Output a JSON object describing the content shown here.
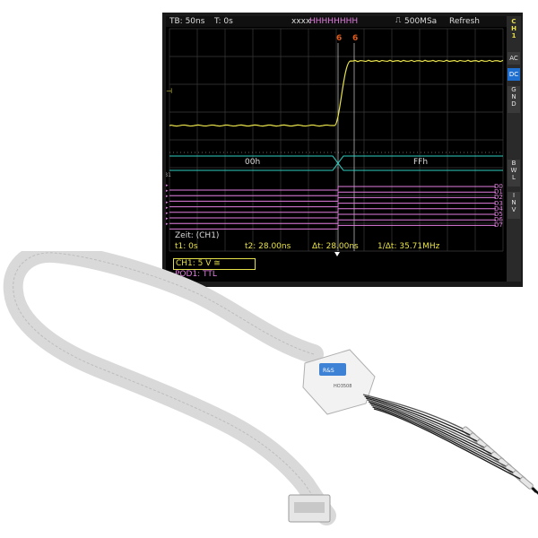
{
  "status_bar": {
    "timebase": "TB: 50ns",
    "trigger_time": "T: 0s",
    "trigger_pattern_x": "xxxx",
    "trigger_pattern_h": "HHHHHHHH",
    "sample_rate": "500MSa",
    "mode": "Refresh"
  },
  "channel_menu": {
    "title_line1": "C",
    "title_line2": "H",
    "title_line3": "1",
    "buttons": [
      {
        "label": "AC"
      },
      {
        "label": "DC",
        "active": true
      },
      {
        "label": "G N D"
      },
      {
        "label": "B W L"
      },
      {
        "label": "I N V"
      }
    ]
  },
  "waveform": {
    "bus_label_left": "00h",
    "bus_label_right": "FFh",
    "digital_labels": [
      "D0",
      "D1",
      "D2",
      "D3",
      "D4",
      "D5",
      "D6",
      "D7"
    ],
    "digital_value_before": 0,
    "digital_value_after": 1,
    "analog_low_level": 0.0,
    "analog_high_level": 5.0,
    "marker_cursor_1": "6",
    "marker_cursor_2": "6",
    "left_marker_b1": "B1"
  },
  "measurement": {
    "title": "Zeit: (CH1)",
    "t1": "t1: 0s",
    "t2": "t2: 28.00ns",
    "dt": "Δt: 28.00ns",
    "inv_dt": "1/Δt: 35.71MHz"
  },
  "channel_info": {
    "ch1": "CH1: 5 V ≅",
    "pod1": "POD1: TTL"
  },
  "hardware": {
    "probe_logo": "R&S",
    "probe_caption": "HO3508"
  },
  "colors": {
    "analog": "#e8e24a",
    "bus": "#2fd1c3",
    "digital": "#e27ee0",
    "cursor": "#e05a1e",
    "grid": "#3a3a3a",
    "accent": "#1f6fd1"
  }
}
